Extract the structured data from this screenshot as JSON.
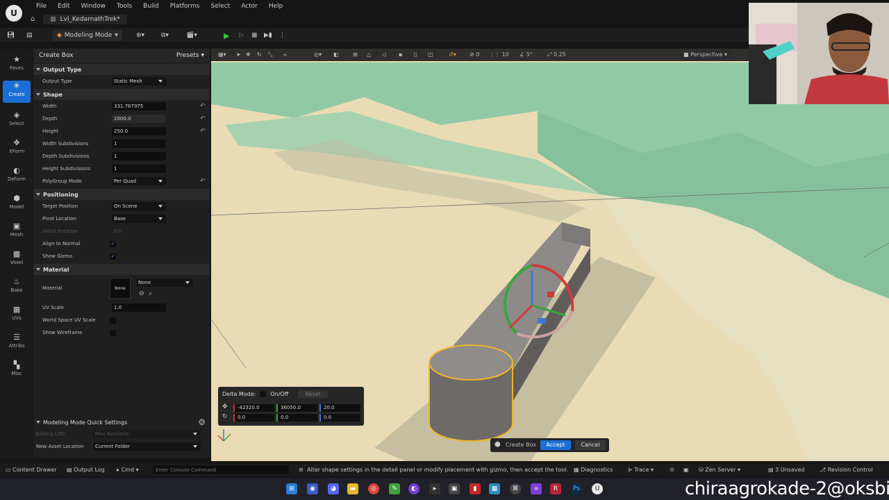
{
  "menu": {
    "items": [
      "File",
      "Edit",
      "Window",
      "Tools",
      "Build",
      "Platforms",
      "Select",
      "Actor",
      "Help"
    ],
    "level_tab": "Lvl_KedarnathTrek*"
  },
  "toolbar": {
    "mode_label": "Modeling Mode"
  },
  "strip": [
    {
      "label": "Faves",
      "icon": "star-icon"
    },
    {
      "label": "Create",
      "icon": "create-icon"
    },
    {
      "label": "Select",
      "icon": "select-icon"
    },
    {
      "label": "XForm",
      "icon": "xform-icon"
    },
    {
      "label": "Deform",
      "icon": "deform-icon"
    },
    {
      "label": "Model",
      "icon": "model-icon"
    },
    {
      "label": "Mesh",
      "icon": "mesh-icon"
    },
    {
      "label": "Voxel",
      "icon": "voxel-icon"
    },
    {
      "label": "Bake",
      "icon": "bake-icon"
    },
    {
      "label": "UVs",
      "icon": "uvs-icon"
    },
    {
      "label": "Attribs",
      "icon": "attribs-icon"
    },
    {
      "label": "Misc",
      "icon": "misc-icon"
    }
  ],
  "panel": {
    "title": "Create Box",
    "presets": "Presets",
    "sections": {
      "output_type": "Output Type",
      "shape": "Shape",
      "positioning": "Positioning",
      "material": "Material"
    },
    "output_type_label": "Output Type",
    "output_type_value": "Static Mesh",
    "width_label": "Width",
    "width_value": "331.767975",
    "depth_label": "Depth",
    "depth_value": "2000.0",
    "height_label": "Height",
    "height_value": "250.0",
    "width_sub_label": "Width Subdivisions",
    "width_sub_value": "1",
    "depth_sub_label": "Depth Subdivisions",
    "depth_sub_value": "1",
    "height_sub_label": "Height Subdivisions",
    "height_sub_value": "1",
    "polygroup_label": "PolyGroup Mode",
    "polygroup_value": "Per Quad",
    "target_label": "Target Position",
    "target_value": "On Scene",
    "pivot_label": "Pivot Location",
    "pivot_value": "Base",
    "initial_rot_label": "Initial Rotation",
    "initial_rot_value": "0.0",
    "align_label": "Align to Normal",
    "gizmo_label": "Show Gizmo",
    "material_label": "Material",
    "material_thumb": "None",
    "material_value": "None",
    "uvscale_label": "UV Scale",
    "uvscale_value": "1.0",
    "worlduv_label": "World Space UV Scale",
    "wireframe_label": "Show Wireframe"
  },
  "quick": {
    "title": "Modeling Mode Quick Settings",
    "lod_label": "Editing LOD",
    "lod_value": "Max Available",
    "asset_label": "New Asset Location",
    "asset_value": "Current Folder"
  },
  "viewport": {
    "view_mode": "Perspective",
    "grid_snap": "10",
    "rot_snap": "5°",
    "scale_snap": "0.25",
    "angle": "0"
  },
  "delta": {
    "label": "Delta Mode:",
    "onoff": "On/Off",
    "reset": "Reset",
    "loc": [
      "-42320.0",
      "36050.0",
      "20.0"
    ],
    "rot": [
      "0.0",
      "0.0",
      "0.0"
    ]
  },
  "accept_bar": {
    "tool": "Create Box",
    "accept": "Accept",
    "cancel": "Cancel"
  },
  "status": {
    "content_drawer": "Content Drawer",
    "output_log": "Output Log",
    "cmd": "Cmd",
    "console_placeholder": "Enter Console Command",
    "hint": "Alter shape settings in the detail panel or modify placement with gizmo, then accept the tool.",
    "diagnostics": "Diagnostics",
    "trace": "Trace",
    "zen": "Zen Server",
    "unsaved": "3 Unsaved",
    "revision": "Revision Control"
  },
  "watermark": "chiraagrokade-2@oksbi",
  "colors": {
    "accent": "#1a6fd6",
    "sand": "#eadcb6",
    "grass": "#8fc9a3"
  }
}
